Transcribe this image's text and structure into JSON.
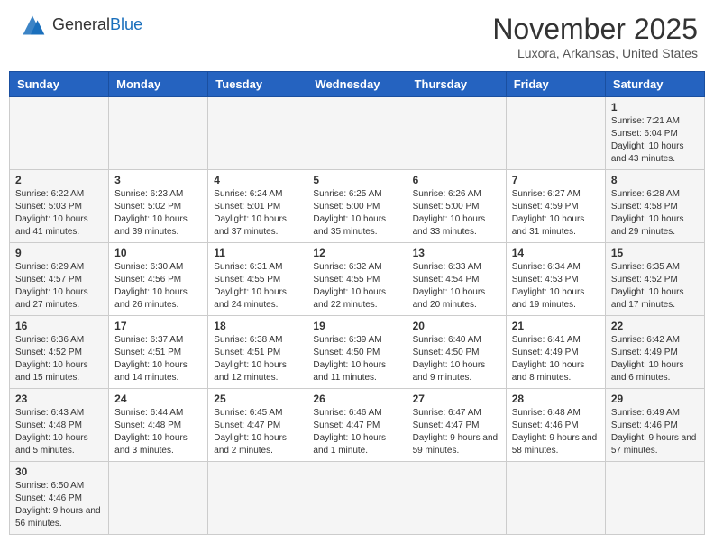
{
  "header": {
    "logo_general": "General",
    "logo_blue": "Blue",
    "month_title": "November 2025",
    "subtitle": "Luxora, Arkansas, United States"
  },
  "days_of_week": [
    "Sunday",
    "Monday",
    "Tuesday",
    "Wednesday",
    "Thursday",
    "Friday",
    "Saturday"
  ],
  "weeks": [
    [
      {
        "day": "",
        "info": ""
      },
      {
        "day": "",
        "info": ""
      },
      {
        "day": "",
        "info": ""
      },
      {
        "day": "",
        "info": ""
      },
      {
        "day": "",
        "info": ""
      },
      {
        "day": "",
        "info": ""
      },
      {
        "day": "1",
        "info": "Sunrise: 7:21 AM\nSunset: 6:04 PM\nDaylight: 10 hours and 43 minutes."
      }
    ],
    [
      {
        "day": "2",
        "info": "Sunrise: 6:22 AM\nSunset: 5:03 PM\nDaylight: 10 hours and 41 minutes."
      },
      {
        "day": "3",
        "info": "Sunrise: 6:23 AM\nSunset: 5:02 PM\nDaylight: 10 hours and 39 minutes."
      },
      {
        "day": "4",
        "info": "Sunrise: 6:24 AM\nSunset: 5:01 PM\nDaylight: 10 hours and 37 minutes."
      },
      {
        "day": "5",
        "info": "Sunrise: 6:25 AM\nSunset: 5:00 PM\nDaylight: 10 hours and 35 minutes."
      },
      {
        "day": "6",
        "info": "Sunrise: 6:26 AM\nSunset: 5:00 PM\nDaylight: 10 hours and 33 minutes."
      },
      {
        "day": "7",
        "info": "Sunrise: 6:27 AM\nSunset: 4:59 PM\nDaylight: 10 hours and 31 minutes."
      },
      {
        "day": "8",
        "info": "Sunrise: 6:28 AM\nSunset: 4:58 PM\nDaylight: 10 hours and 29 minutes."
      }
    ],
    [
      {
        "day": "9",
        "info": "Sunrise: 6:29 AM\nSunset: 4:57 PM\nDaylight: 10 hours and 27 minutes."
      },
      {
        "day": "10",
        "info": "Sunrise: 6:30 AM\nSunset: 4:56 PM\nDaylight: 10 hours and 26 minutes."
      },
      {
        "day": "11",
        "info": "Sunrise: 6:31 AM\nSunset: 4:55 PM\nDaylight: 10 hours and 24 minutes."
      },
      {
        "day": "12",
        "info": "Sunrise: 6:32 AM\nSunset: 4:55 PM\nDaylight: 10 hours and 22 minutes."
      },
      {
        "day": "13",
        "info": "Sunrise: 6:33 AM\nSunset: 4:54 PM\nDaylight: 10 hours and 20 minutes."
      },
      {
        "day": "14",
        "info": "Sunrise: 6:34 AM\nSunset: 4:53 PM\nDaylight: 10 hours and 19 minutes."
      },
      {
        "day": "15",
        "info": "Sunrise: 6:35 AM\nSunset: 4:52 PM\nDaylight: 10 hours and 17 minutes."
      }
    ],
    [
      {
        "day": "16",
        "info": "Sunrise: 6:36 AM\nSunset: 4:52 PM\nDaylight: 10 hours and 15 minutes."
      },
      {
        "day": "17",
        "info": "Sunrise: 6:37 AM\nSunset: 4:51 PM\nDaylight: 10 hours and 14 minutes."
      },
      {
        "day": "18",
        "info": "Sunrise: 6:38 AM\nSunset: 4:51 PM\nDaylight: 10 hours and 12 minutes."
      },
      {
        "day": "19",
        "info": "Sunrise: 6:39 AM\nSunset: 4:50 PM\nDaylight: 10 hours and 11 minutes."
      },
      {
        "day": "20",
        "info": "Sunrise: 6:40 AM\nSunset: 4:50 PM\nDaylight: 10 hours and 9 minutes."
      },
      {
        "day": "21",
        "info": "Sunrise: 6:41 AM\nSunset: 4:49 PM\nDaylight: 10 hours and 8 minutes."
      },
      {
        "day": "22",
        "info": "Sunrise: 6:42 AM\nSunset: 4:49 PM\nDaylight: 10 hours and 6 minutes."
      }
    ],
    [
      {
        "day": "23",
        "info": "Sunrise: 6:43 AM\nSunset: 4:48 PM\nDaylight: 10 hours and 5 minutes."
      },
      {
        "day": "24",
        "info": "Sunrise: 6:44 AM\nSunset: 4:48 PM\nDaylight: 10 hours and 3 minutes."
      },
      {
        "day": "25",
        "info": "Sunrise: 6:45 AM\nSunset: 4:47 PM\nDaylight: 10 hours and 2 minutes."
      },
      {
        "day": "26",
        "info": "Sunrise: 6:46 AM\nSunset: 4:47 PM\nDaylight: 10 hours and 1 minute."
      },
      {
        "day": "27",
        "info": "Sunrise: 6:47 AM\nSunset: 4:47 PM\nDaylight: 9 hours and 59 minutes."
      },
      {
        "day": "28",
        "info": "Sunrise: 6:48 AM\nSunset: 4:46 PM\nDaylight: 9 hours and 58 minutes."
      },
      {
        "day": "29",
        "info": "Sunrise: 6:49 AM\nSunset: 4:46 PM\nDaylight: 9 hours and 57 minutes."
      }
    ],
    [
      {
        "day": "30",
        "info": "Sunrise: 6:50 AM\nSunset: 4:46 PM\nDaylight: 9 hours and 56 minutes."
      },
      {
        "day": "",
        "info": ""
      },
      {
        "day": "",
        "info": ""
      },
      {
        "day": "",
        "info": ""
      },
      {
        "day": "",
        "info": ""
      },
      {
        "day": "",
        "info": ""
      },
      {
        "day": "",
        "info": ""
      }
    ]
  ]
}
